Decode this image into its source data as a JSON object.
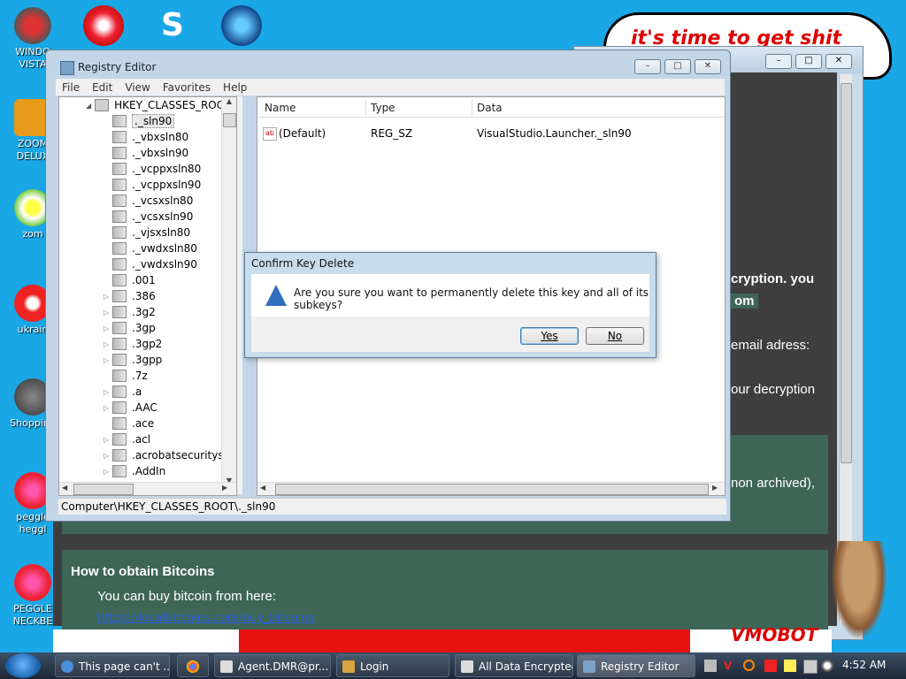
{
  "desktop": {
    "icons": [
      {
        "label": "WINDO VISTA"
      },
      {
        "label": "ZOOM DELUX"
      },
      {
        "label": "zom"
      },
      {
        "label": "ukrain"
      },
      {
        "label": "Shopping"
      },
      {
        "label": "peggle heggl"
      },
      {
        "label": "PEGGLE NECKBE"
      }
    ]
  },
  "ransom_page": {
    "cloud_text": "it's time to get shit",
    "line1": "cryption. you",
    "line2": "om",
    "line3": "email adress:",
    "line4": "our decryption",
    "line5": "non archived),",
    "heading": "How to obtain Bitcoins",
    "buy_text": "You can buy bitcoin from here:",
    "link": "https://localbitcoins.com/buy_bitcoins",
    "bottom_art": "VMOBOT"
  },
  "regedit": {
    "title": "Registry Editor",
    "menu": [
      "File",
      "Edit",
      "View",
      "Favorites",
      "Help"
    ],
    "root": "HKEY_CLASSES_ROOT",
    "nodes": [
      {
        "label": "._sln90",
        "expandable": false,
        "selected": true
      },
      {
        "label": "._vbxsln80",
        "expandable": false
      },
      {
        "label": "._vbxsln90",
        "expandable": false
      },
      {
        "label": "._vcppxsln80",
        "expandable": false
      },
      {
        "label": "._vcppxsln90",
        "expandable": false
      },
      {
        "label": "._vcsxsln80",
        "expandable": false
      },
      {
        "label": "._vcsxsln90",
        "expandable": false
      },
      {
        "label": "._vjsxsln80",
        "expandable": false
      },
      {
        "label": "._vwdxsln80",
        "expandable": false
      },
      {
        "label": "._vwdxsln90",
        "expandable": false
      },
      {
        "label": ".001",
        "expandable": false
      },
      {
        "label": ".386",
        "expandable": true
      },
      {
        "label": ".3g2",
        "expandable": true
      },
      {
        "label": ".3gp",
        "expandable": true
      },
      {
        "label": ".3gp2",
        "expandable": true
      },
      {
        "label": ".3gpp",
        "expandable": true
      },
      {
        "label": ".7z",
        "expandable": false
      },
      {
        "label": ".a",
        "expandable": true
      },
      {
        "label": ".AAC",
        "expandable": true
      },
      {
        "label": ".ace",
        "expandable": false
      },
      {
        "label": ".acl",
        "expandable": true
      },
      {
        "label": ".acrobatsecuritysettin",
        "expandable": true
      },
      {
        "label": ".AddIn",
        "expandable": true
      }
    ],
    "columns": {
      "name": "Name",
      "type": "Type",
      "data": "Data"
    },
    "values": [
      {
        "name": "(Default)",
        "type": "REG_SZ",
        "data": "VisualStudio.Launcher._sln90"
      }
    ],
    "status": "Computer\\HKEY_CLASSES_ROOT\\._sln90"
  },
  "dialog": {
    "title": "Confirm Key Delete",
    "message": "Are you sure you want to permanently delete this key and all of its subkeys?",
    "yes": "Yes",
    "no": "No"
  },
  "taskbar": {
    "buttons": [
      {
        "label": "This page can't ...",
        "icon": "ie-icon"
      },
      {
        "label": "",
        "icon": "chrome-icon"
      },
      {
        "label": "Agent.DMR@pr...",
        "icon": "window-icon"
      },
      {
        "label": "Login",
        "icon": "login-icon"
      },
      {
        "label": "All Data Encrypted",
        "icon": "window-icon"
      },
      {
        "label": "Registry Editor",
        "icon": "regedit-icon"
      }
    ],
    "clock": "4:52 AM"
  },
  "colors": {
    "desktop": "#1aa7e6",
    "ransom_bg": "#3e3e3e",
    "ransom_panel": "#3e6656",
    "dialog_frame": "#c7dced"
  }
}
